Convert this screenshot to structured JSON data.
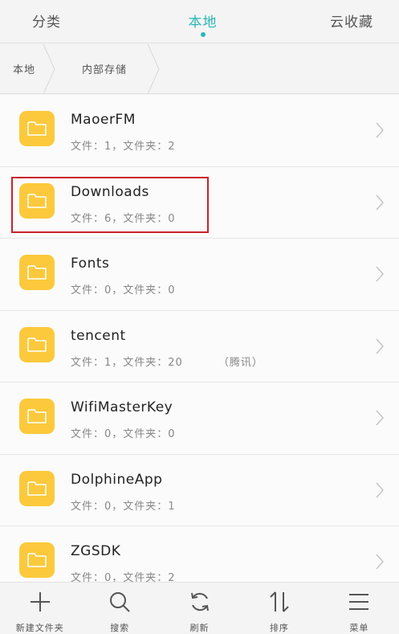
{
  "top_tabs": [
    {
      "label": "分类"
    },
    {
      "label": "本地"
    },
    {
      "label": "云收藏"
    }
  ],
  "breadcrumb": [
    {
      "label": "本地"
    },
    {
      "label": "内部存储"
    }
  ],
  "folders": [
    {
      "name": "MaoerFM",
      "meta": "文件：1，文件夹：2",
      "extra": ""
    },
    {
      "name": "Downloads",
      "meta": "文件：6，文件夹：0",
      "extra": ""
    },
    {
      "name": "Fonts",
      "meta": "文件：0，文件夹：0",
      "extra": ""
    },
    {
      "name": "tencent",
      "meta": "文件：1，文件夹：20",
      "extra": "（腾讯）"
    },
    {
      "name": "WifiMasterKey",
      "meta": "文件：0，文件夹：0",
      "extra": ""
    },
    {
      "name": "DolphineApp",
      "meta": "文件：0，文件夹：1",
      "extra": ""
    },
    {
      "name": "ZGSDK",
      "meta": "文件：0，文件夹：2",
      "extra": ""
    }
  ],
  "toolbar": [
    {
      "label": "新建文件夹",
      "icon": "plus-icon"
    },
    {
      "label": "搜索",
      "icon": "search-icon"
    },
    {
      "label": "刷新",
      "icon": "refresh-icon"
    },
    {
      "label": "排序",
      "icon": "sort-icon"
    },
    {
      "label": "菜单",
      "icon": "menu-icon"
    }
  ],
  "colors": {
    "accent": "#2bb6b6",
    "folder": "#fcc93c",
    "highlight": "#c8232c"
  }
}
